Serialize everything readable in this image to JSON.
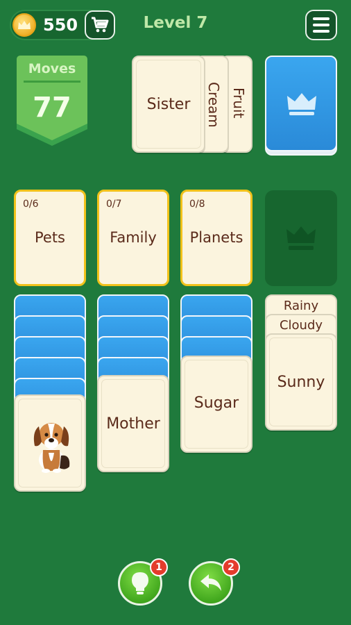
{
  "header": {
    "coins": "550",
    "level": "Level 7"
  },
  "moves": {
    "label": "Moves",
    "value": "77"
  },
  "stock": {
    "top_card": "Sister",
    "side_cards": [
      "Cream",
      "Fruit"
    ]
  },
  "foundations": [
    {
      "count": "0/6",
      "category": "Pets"
    },
    {
      "count": "0/7",
      "category": "Family"
    },
    {
      "count": "0/8",
      "category": "Planets"
    }
  ],
  "tableau": {
    "col1": {
      "face_down": 5,
      "face_up": "dog-picture"
    },
    "col2": {
      "face_down": 4,
      "face_up": "Mother"
    },
    "col3": {
      "face_down": 3,
      "face_up": "Sugar"
    },
    "col4": {
      "cards": [
        "Rainy",
        "Cloudy",
        "Sunny"
      ]
    }
  },
  "controls": {
    "hint_badge": "1",
    "undo_badge": "2"
  },
  "icons": [
    "crown-coin-icon",
    "cart-icon",
    "menu-icon",
    "crown-icon",
    "lightbulb-icon",
    "undo-icon",
    "dog-icon"
  ],
  "colors": {
    "table": "#1f7a3c",
    "card": "#fbf4de",
    "card_back": "#2a8ad8",
    "foundation_border": "#f1c21b"
  }
}
